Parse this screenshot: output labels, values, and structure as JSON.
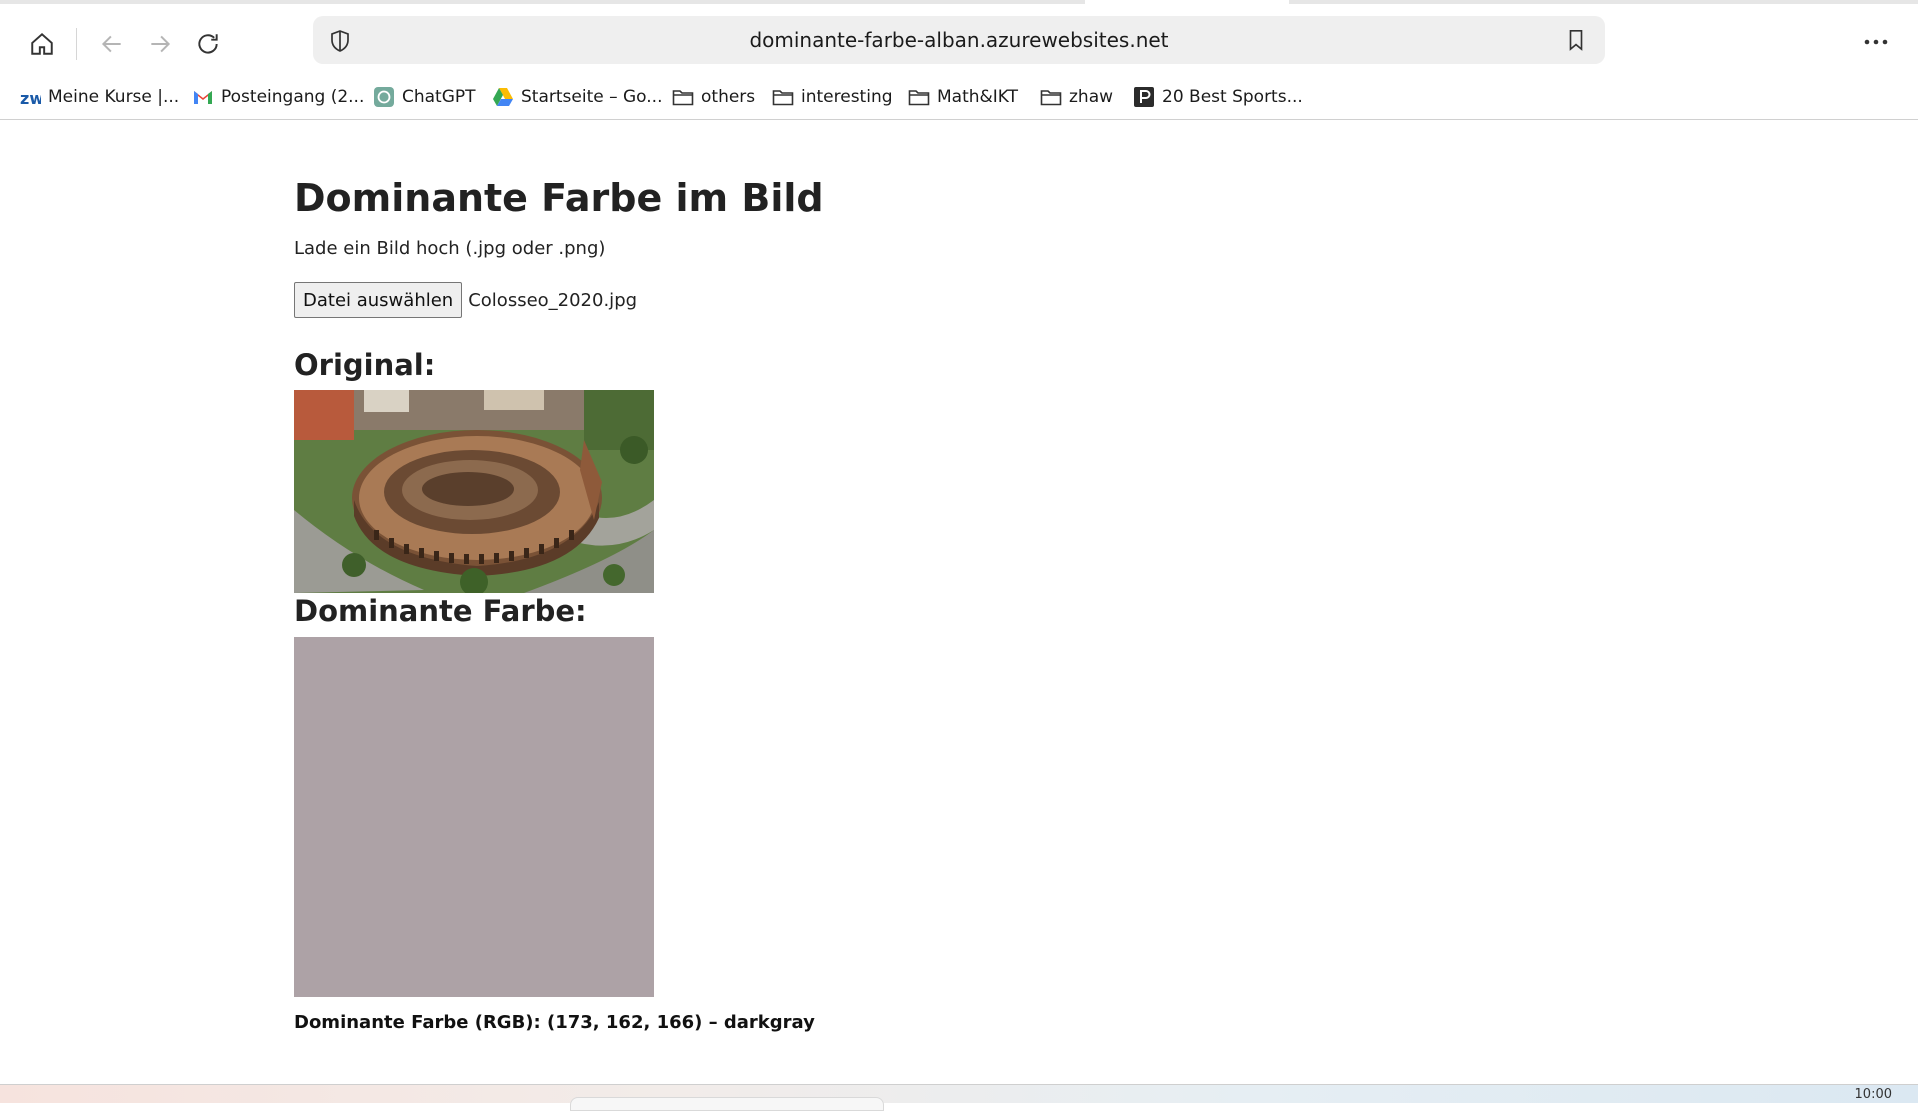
{
  "browser": {
    "url": "dominante-farbe-alban.azurewebsites.net",
    "bookmarks": [
      {
        "label": "Meine Kurse |...",
        "icon": "zhaw-icon"
      },
      {
        "label": "Posteingang (2...",
        "icon": "gmail-icon"
      },
      {
        "label": "ChatGPT",
        "icon": "chatgpt-icon"
      },
      {
        "label": "Startseite – Go...",
        "icon": "google-drive-icon"
      },
      {
        "label": "others",
        "icon": "folder-icon"
      },
      {
        "label": "interesting",
        "icon": "folder-icon"
      },
      {
        "label": "Math&IKT",
        "icon": "folder-icon"
      },
      {
        "label": "zhaw",
        "icon": "folder-icon"
      },
      {
        "label": "20 Best Sports...",
        "icon": "site-icon"
      }
    ]
  },
  "page": {
    "title": "Dominante Farbe im Bild",
    "intro": "Lade ein Bild hoch (.jpg oder .png)",
    "file_button": "Datei auswählen",
    "file_name": "Colosseo_2020.jpg",
    "original_heading": "Original:",
    "dominant_heading": "Dominante Farbe:",
    "dominant_color": "#ada2a6",
    "result_text": "Dominante Farbe (RGB): (173, 162, 166) – darkgray"
  },
  "taskbar": {
    "clock": "10:00"
  }
}
